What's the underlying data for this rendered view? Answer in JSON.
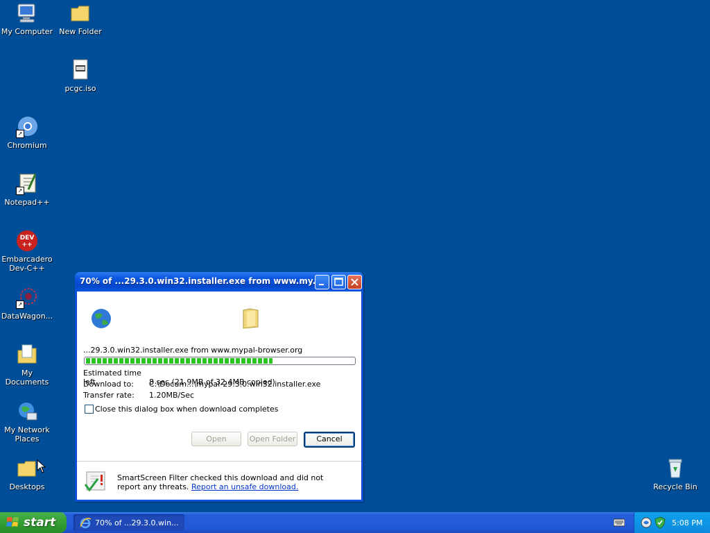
{
  "desktop": {
    "icons": [
      {
        "label": "My Computer"
      },
      {
        "label": "New Folder"
      },
      {
        "label": "pcgc.iso"
      },
      {
        "label": "Chromium"
      },
      {
        "label": "Notepad++"
      },
      {
        "label": "Embarcadero Dev-C++"
      },
      {
        "label": "DataWagon..."
      },
      {
        "label": "My Documents"
      },
      {
        "label": "My Network Places"
      },
      {
        "label": "Desktops"
      },
      {
        "label": "Recycle Bin"
      }
    ]
  },
  "dialog": {
    "title": "70% of ...29.3.0.win32.installer.exe from www.my...",
    "file_source": "...29.3.0.win32.installer.exe from www.mypal-browser.org",
    "progress": 70,
    "info": [
      {
        "key": "Estimated time left",
        "value": "8 sec (21.9MB of 32.4MB copied)"
      },
      {
        "key": "Download to:",
        "value": "C:\\Docum...\\mypal-29.3.0.win32.installer.exe"
      },
      {
        "key": "Transfer rate:",
        "value": "1.20MB/Sec"
      }
    ],
    "close_checkbox_label": "Close this dialog box when download completes",
    "buttons": {
      "open": "Open",
      "open_folder": "Open Folder",
      "cancel": "Cancel"
    },
    "smartscreen_text": "SmartScreen Filter checked this download and did not report any threats.",
    "report_link": "Report an unsafe download."
  },
  "taskbar": {
    "start_label": "start",
    "task_label": "70% of ...29.3.0.win...",
    "clock": "5:08 PM"
  },
  "colors": {
    "desktop": "#004e98",
    "accent": "#0b4fd8"
  }
}
